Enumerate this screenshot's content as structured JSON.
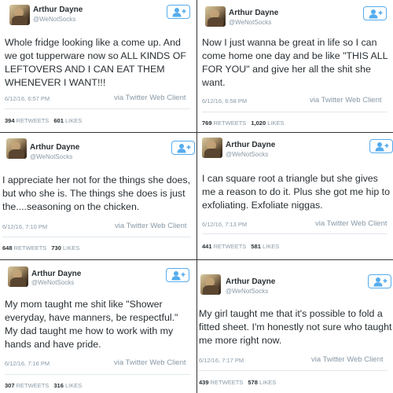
{
  "tweets": [
    {
      "name": "Arthur Dayne",
      "handle": "@WeNotSocks",
      "text": "Whole fridge looking like a come up. And we got tupperware now so ALL KINDS OF LEFTOVERS AND I CAN EAT THEM WHENEVER I WANT!!!",
      "timestamp": "6/12/16, 6:57 PM",
      "via": "via Twitter Web Client",
      "retweets": "394",
      "retweets_label": "RETWEETS",
      "likes": "601",
      "likes_label": "LIKES"
    },
    {
      "name": "Arthur Dayne",
      "handle": "@WeNotSocks",
      "text": "Now I just wanna be great in life so I can come home one day and be like \"THIS ALL FOR YOU\" and give her all the shit she want.",
      "timestamp": "6/12/16, 6:58 PM",
      "via": "via Twitter Web Client",
      "retweets": "769",
      "retweets_label": "RETWEETS",
      "likes": "1,020",
      "likes_label": "LIKES"
    },
    {
      "name": "Arthur Dayne",
      "handle": "@WeNotSocks",
      "text": "I appreciate her not for the things she does, but who she is. The things she does is just the....seasoning on the chicken.",
      "timestamp": "6/12/16, 7:10 PM",
      "via": "via Twitter Web Client",
      "retweets": "648",
      "retweets_label": "RETWEETS",
      "likes": "730",
      "likes_label": "LIKES"
    },
    {
      "name": "Arthur Dayne",
      "handle": "@WeNotSocks",
      "text": "I can square root a triangle but she gives me a reason to do it. Plus she got me hip to exfoliating. Exfoliate niggas.",
      "timestamp": "6/12/16, 7:13 PM",
      "via": "via Twitter Web Client",
      "retweets": "441",
      "retweets_label": "RETWEETS",
      "likes": "581",
      "likes_label": "LIKES"
    },
    {
      "name": "Arthur Dayne",
      "handle": "@WeNotSocks",
      "text": "My mom taught me shit like \"Shower everyday, have manners, be respectful.\" My dad taught me how to work with my hands and have pride.",
      "timestamp": "6/12/16, 7:16 PM",
      "via": "via Twitter Web Client",
      "retweets": "307",
      "retweets_label": "RETWEETS",
      "likes": "316",
      "likes_label": "LIKES"
    },
    {
      "name": "Arthur Dayne",
      "handle": "@WeNotSocks",
      "text": "My girl taught me that it's possible to fold a fitted sheet. I'm honestly not sure who taught me more right now.",
      "timestamp": "6/12/16, 7:17 PM",
      "via": "via Twitter Web Client",
      "retweets": "439",
      "retweets_label": "RETWEETS",
      "likes": "578",
      "likes_label": "LIKES"
    }
  ],
  "colors": {
    "twitter_blue": "#55acee",
    "meta_gray": "#8899a6",
    "text_dark": "#292f33"
  },
  "icons": {
    "follow": "follow-person-plus-icon",
    "avatar": "profile-avatar"
  }
}
